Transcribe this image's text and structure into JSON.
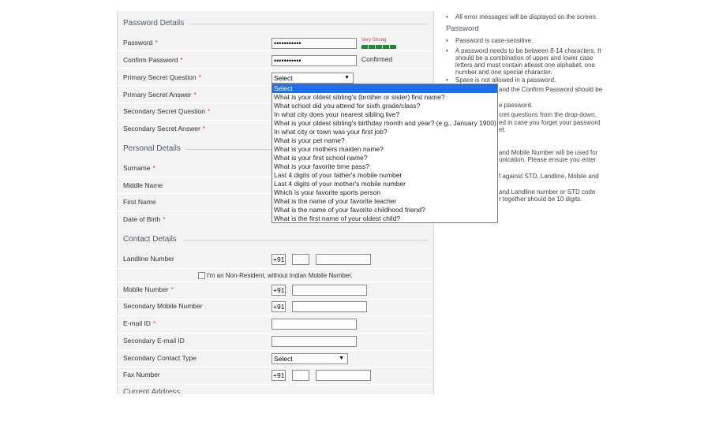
{
  "sections": {
    "password_details": "Password Details",
    "personal_details": "Personal Details",
    "contact_details": "Contact Details",
    "current_address": "Current Address"
  },
  "password": {
    "label": "Password",
    "value": "•••••••••••",
    "strength_label": "Very Strong",
    "strength_bars": 5,
    "strength_color": "#1e8b2e"
  },
  "confirm_password": {
    "label": "Confirm Password",
    "value": "•••••••••••",
    "status": "Confirmed"
  },
  "primary_question": {
    "label": "Primary Secret Question",
    "selected": "Select"
  },
  "primary_answer": {
    "label": "Primary Secret Answer"
  },
  "secondary_question": {
    "label": "Secondary Secret Question"
  },
  "secondary_answer": {
    "label": "Secondary Secret Answer"
  },
  "surname": {
    "label": "Surname"
  },
  "middle_name": {
    "label": "Middle Name"
  },
  "first_name": {
    "label": "First Name"
  },
  "dob": {
    "label": "Date of Birth"
  },
  "dropdown_options": [
    "Select",
    "What is your oldest sibling's (brother or sister) first name?",
    "What school did you attend for sixth grade/class?",
    "In what city does your nearest sibling live?",
    "What is your oldest sibling's birthday month and year? (e.g., January 1900)",
    "In what city or town was your first job?",
    "What is your pet name?",
    "What is your mothers maiden name?",
    "What is your first school name?",
    "What is your favorite time pass?",
    "Last 4 digits of your father's mobile number",
    "Last 4 digits of your mother's mobile number",
    "Which is your favorite sports person",
    "What is the name of your favorite teacher",
    "What is the name of your favorite childhood friend?",
    "What is the first name of your oldest child?"
  ],
  "landline": {
    "label": "Landline Number",
    "prefix": "+91"
  },
  "nri_checkbox": {
    "label": "I'm an Non-Resident, without Indian Mobile Number."
  },
  "mobile": {
    "label": "Mobile Number",
    "prefix": "+91"
  },
  "secondary_mobile": {
    "label": "Secondary Mobile Number",
    "prefix": "+91"
  },
  "email": {
    "label": "E-mail ID"
  },
  "secondary_email": {
    "label": "Secondary E-mail ID"
  },
  "secondary_contact_type": {
    "label": "Secondary Contact Type",
    "selected": "Select"
  },
  "fax": {
    "label": "Fax Number",
    "prefix": "+91"
  },
  "required_marker": "*",
  "help": {
    "top_note": "All error messages will be displayed on the screen.",
    "password_title": "Password",
    "items": [
      "Password is case-sensitive.",
      "A password needs to be between 8-14 characters. It",
      "should be a combination of upper and lower case",
      "letters and must contain atleast one alphabet, one",
      "number and one special character.",
      "Space is not allowed in a password.",
      "and the Confirm Password should be",
      "e password.",
      "cret questions from the drop-down.",
      "ed in case you forget your password",
      "et.",
      "and Mobile Number will be used for",
      "unication. Please ensure you enter",
      "f against STD, Landline, Mobile and",
      "and Landline number or STD code",
      "r together should be 10 digits."
    ]
  }
}
